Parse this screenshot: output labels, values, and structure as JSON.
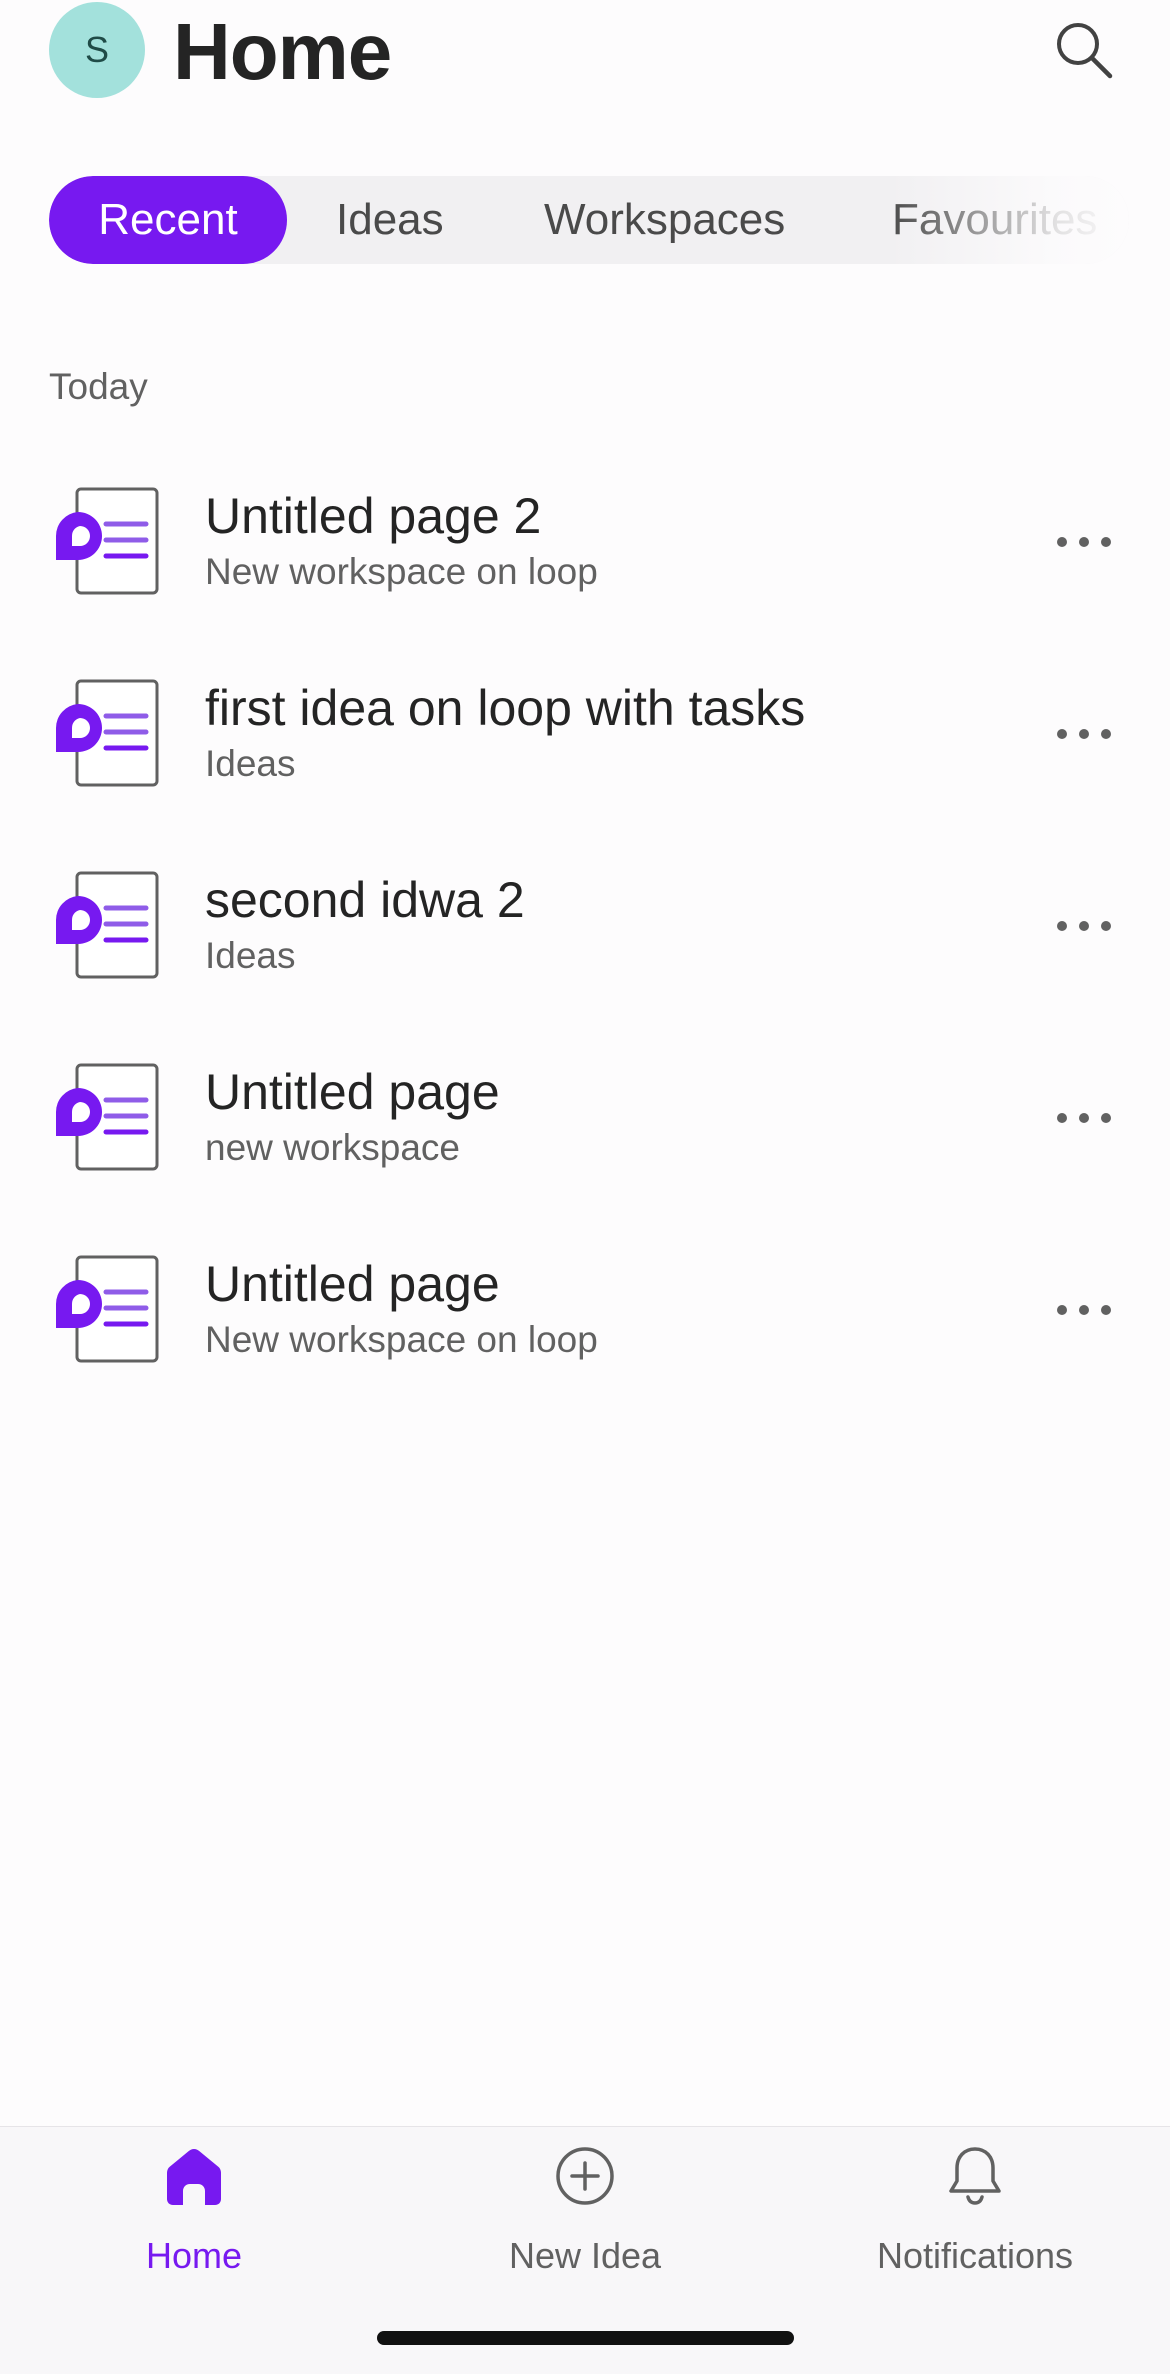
{
  "header": {
    "avatar_initial": "S",
    "title": "Home",
    "search_icon": "search-icon"
  },
  "tabs": [
    {
      "label": "Recent",
      "active": true
    },
    {
      "label": "Ideas",
      "active": false
    },
    {
      "label": "Workspaces",
      "active": false
    },
    {
      "label": "Favourites",
      "active": false
    }
  ],
  "section": {
    "label": "Today"
  },
  "items": [
    {
      "title": "Untitled page 2",
      "subtitle": "New workspace on loop",
      "icon": "loop-page-icon"
    },
    {
      "title": "first idea on loop with tasks",
      "subtitle": "Ideas",
      "icon": "loop-page-icon"
    },
    {
      "title": "second idwa 2",
      "subtitle": "Ideas",
      "icon": "loop-page-icon"
    },
    {
      "title": "Untitled page",
      "subtitle": "new workspace",
      "icon": "loop-page-icon"
    },
    {
      "title": "Untitled page",
      "subtitle": "New workspace on loop",
      "icon": "loop-page-icon"
    }
  ],
  "bottom_nav": [
    {
      "label": "Home",
      "icon": "home-icon",
      "active": true
    },
    {
      "label": "New Idea",
      "icon": "add-circle-icon",
      "active": false
    },
    {
      "label": "Notifications",
      "icon": "bell-icon",
      "active": false
    }
  ],
  "colors": {
    "accent": "#7719f0",
    "avatar_bg": "#a3e1dc",
    "tab_track": "#f1f0f2",
    "secondary_text": "#616161"
  }
}
